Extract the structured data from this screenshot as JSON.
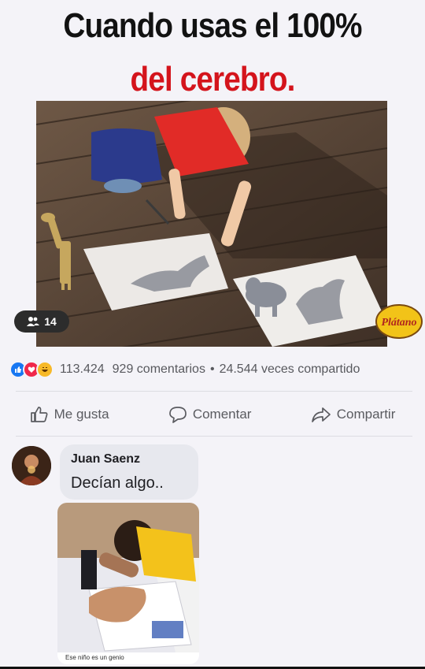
{
  "meme": {
    "title_line1": "Cuando usas el 100%",
    "title_line2": "del cerebro.",
    "group_badge_count": "14",
    "watermark_logo": "Plátano"
  },
  "post_stats": {
    "reaction_icons": [
      "like-icon",
      "love-icon",
      "haha-icon"
    ],
    "reactions_count": "113.424",
    "comments": "929 comentarios",
    "separator": "•",
    "shares": "24.544 veces compartido"
  },
  "actions": {
    "like_label": "Me gusta",
    "comment_label": "Comentar",
    "share_label": "Compartir"
  },
  "comment": {
    "author": "Juan Saenz",
    "text": "Decían algo..",
    "image_caption": "Ese niño es un genio"
  },
  "colors": {
    "title_dark": "#121212",
    "title_red": "#d4141c",
    "like_blue": "#1877f2",
    "love_red": "#f0284a",
    "haha_yellow": "#f7b928"
  }
}
